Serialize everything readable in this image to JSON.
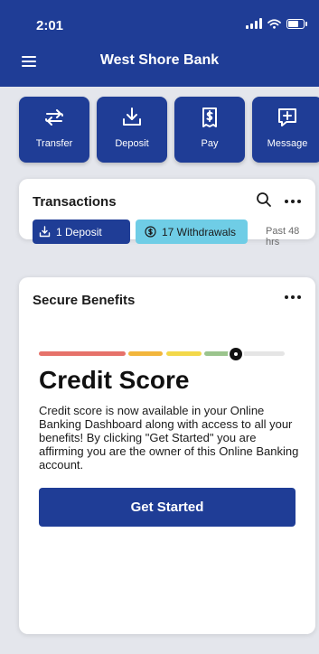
{
  "status": {
    "time": "2:01"
  },
  "header": {
    "title": "West Shore Bank"
  },
  "actions": [
    {
      "label": "Transfer",
      "icon": "transfer-icon"
    },
    {
      "label": "Deposit",
      "icon": "deposit-icon"
    },
    {
      "label": "Pay",
      "icon": "pay-icon"
    },
    {
      "label": "Message",
      "icon": "message-icon"
    }
  ],
  "transactions": {
    "title": "Transactions",
    "deposit_chip": "1 Deposit",
    "withdrawals_chip": "17 Withdrawals",
    "period": "Past 48 hrs"
  },
  "benefits": {
    "title": "Secure Benefits",
    "score_segments": [
      "#e6726a",
      "#f2b63c",
      "#f3d84a",
      "#9bc48d",
      "#e5e5e5"
    ],
    "score_level_fraction": 0.8,
    "heading": "Credit Score",
    "body": "Credit score is now available in your Online Banking Dashboard along with access to all your benefits! By clicking \"Get Started\" you are affirming you are the owner of this Online Banking account.",
    "button": "Get Started"
  },
  "colors": {
    "brand": "#1f3d96",
    "accent": "#6fcde6"
  }
}
